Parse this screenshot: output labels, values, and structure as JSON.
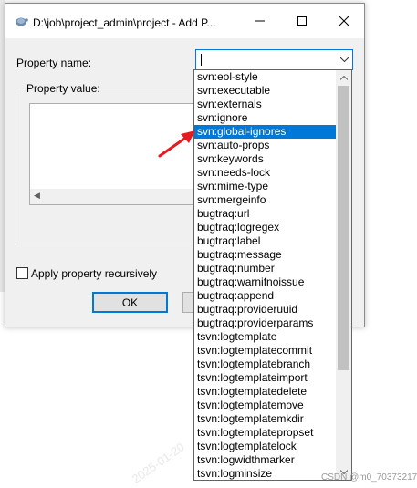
{
  "dialog": {
    "title": "D:\\job\\project_admin\\project - Add P...",
    "property_name_label": "Property name:",
    "property_name_value": "",
    "property_value_label": "Property value:",
    "apply_recursive_label": "Apply property recursively",
    "apply_recursive_checked": false,
    "ok_label": "OK"
  },
  "dropdown": {
    "selected": "svn:global-ignores",
    "items": [
      "svn:eol-style",
      "svn:executable",
      "svn:externals",
      "svn:ignore",
      "svn:global-ignores",
      "svn:auto-props",
      "svn:keywords",
      "svn:needs-lock",
      "svn:mime-type",
      "svn:mergeinfo",
      "bugtraq:url",
      "bugtraq:logregex",
      "bugtraq:label",
      "bugtraq:message",
      "bugtraq:number",
      "bugtraq:warnifnoissue",
      "bugtraq:append",
      "bugtraq:provideruuid",
      "bugtraq:providerparams",
      "tsvn:logtemplate",
      "tsvn:logtemplatecommit",
      "tsvn:logtemplatebranch",
      "tsvn:logtemplateimport",
      "tsvn:logtemplatedelete",
      "tsvn:logtemplatemove",
      "tsvn:logtemplatemkdir",
      "tsvn:logtemplatepropset",
      "tsvn:logtemplatelock",
      "tsvn:logwidthmarker",
      "tsvn:logminsize"
    ]
  },
  "footer": {
    "credit": "CSDN @m0_70373217"
  },
  "colors": {
    "accent": "#0078d7",
    "annotation_arrow": "#e8191f"
  }
}
